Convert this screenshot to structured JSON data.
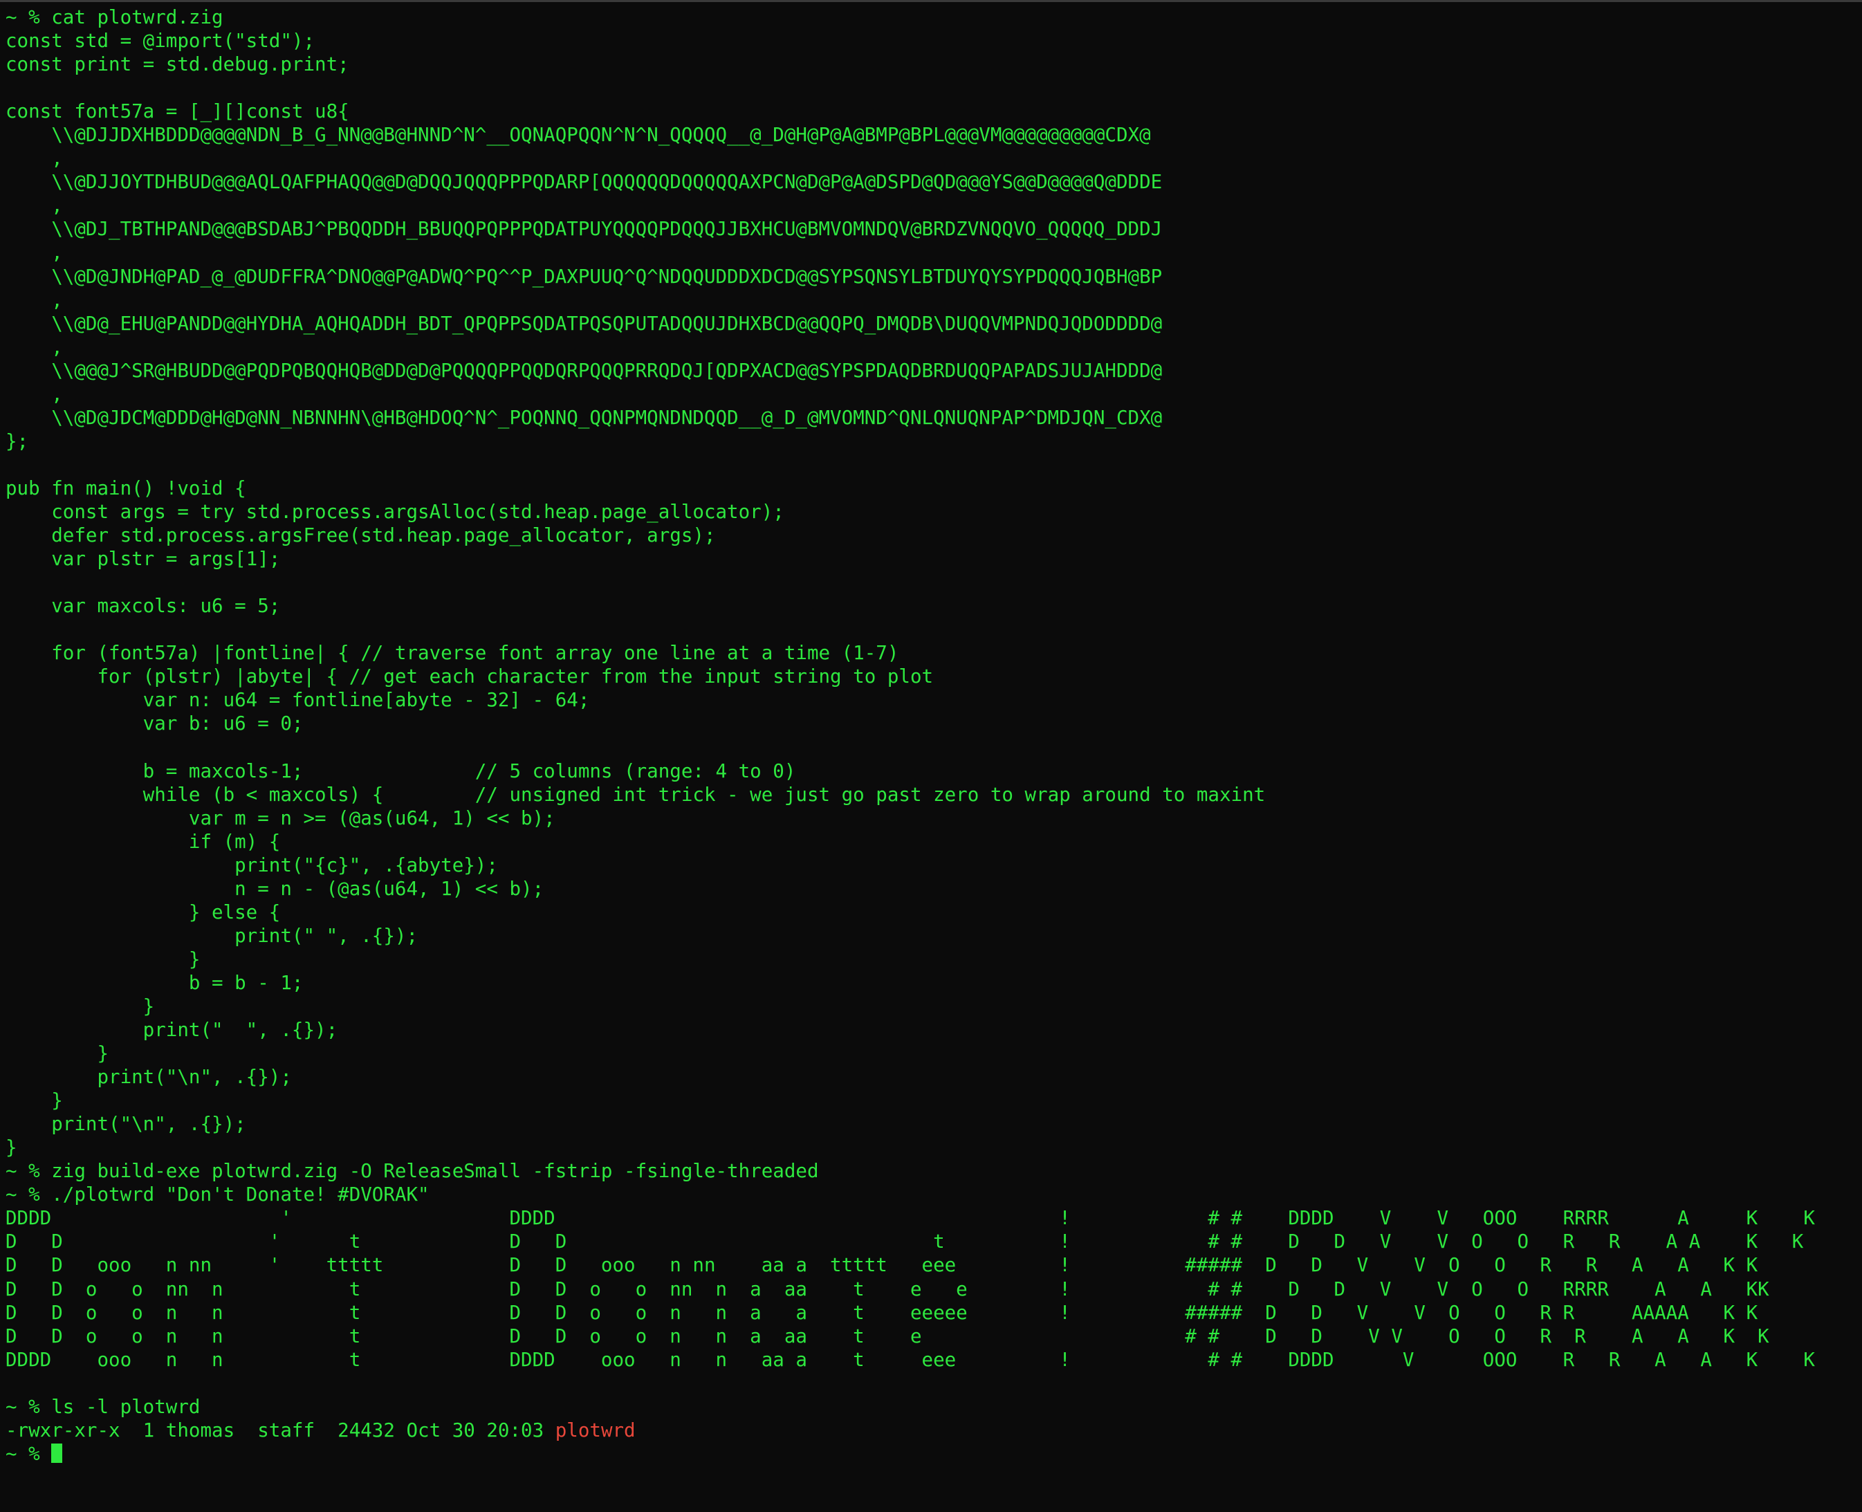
{
  "colors": {
    "background": "#0b0b0b",
    "text": "#2ee83f",
    "filename_highlight": "#e8473a"
  },
  "terminal": {
    "lines": [
      "~ % cat plotwrd.zig",
      "const std = @import(\"std\");",
      "const print = std.debug.print;",
      "",
      "const font57a = [_][]const u8{",
      "    \\\\@DJJDXHBDDD@@@@NDN_B_G_NN@@B@HNND^N^__OQNAQPQQN^N^N_QQQQQ__@_D@H@P@A@BMP@BPL@@@VM@@@@@@@@@CDX@",
      "    ,",
      "    \\\\@DJJOYTDHBUD@@@AQLQAFPHAQQ@@D@DQQJQQQPPPQDARP[QQQQQQDQQQQQAXPCN@D@P@A@DSPD@QD@@@YS@@D@@@@Q@DDDE",
      "    ,",
      "    \\\\@DJ_TBTHPAND@@@BSDABJ^PBQQDDH_BBUQQPQPPPQDATPUYQQQQPDQQQJJBXHCU@BMVOMNDQV@BRDZVNQQVO_QQQQQ_DDDJ",
      "    ,",
      "    \\\\@D@JNDH@PAD_@_@DUDFFRA^DNO@@P@ADWQ^PQ^^P_DAXPUUQ^Q^NDQQUDDDXDCD@@SYPSQNSYLBTDUYQYSYPDQQQJQBH@BP",
      "    ,",
      "    \\\\@D@_EHU@PANDD@@HYDHA_AQHQADDH_BDT_QPQPPSQDATPQSQPUTADQQUJDHXBCD@@QQPQ_DMQDB\\DUQQVMPNDQJQDODDDD@",
      "    ,",
      "    \\\\@@@J^SR@HBUDD@@PQDPQBQQHQB@DD@D@PQQQQPPQQDQRPQQQPRRQDQJ[QDPXACD@@SYPSPDAQDBRDUQQPAPADSJUJAHDDD@",
      "    ,",
      "    \\\\@D@JDCM@DDD@H@D@NN_NBNNHN\\@HB@HDOQ^N^_POQNNQ_QQNPMQNDNDQQD__@_D_@MVOMND^QNLQNUQNPAP^DMDJQN_CDX@",
      "};",
      "",
      "pub fn main() !void {",
      "    const args = try std.process.argsAlloc(std.heap.page_allocator);",
      "    defer std.process.argsFree(std.heap.page_allocator, args);",
      "    var plstr = args[1];",
      "",
      "    var maxcols: u6 = 5;",
      "",
      "    for (font57a) |fontline| { // traverse font array one line at a time (1-7)",
      "        for (plstr) |abyte| { // get each character from the input string to plot",
      "            var n: u64 = fontline[abyte - 32] - 64;",
      "            var b: u6 = 0;",
      "",
      "            b = maxcols-1;               // 5 columns (range: 4 to 0)",
      "            while (b < maxcols) {        // unsigned int trick - we just go past zero to wrap around to maxint",
      "                var m = n >= (@as(u64, 1) << b);",
      "                if (m) {",
      "                    print(\"{c}\", .{abyte});",
      "                    n = n - (@as(u64, 1) << b);",
      "                } else {",
      "                    print(\" \", .{});",
      "                }",
      "                b = b - 1;",
      "            }",
      "            print(\"  \", .{});",
      "        }",
      "        print(\"\\n\", .{});",
      "    }",
      "    print(\"\\n\", .{});",
      "}",
      "~ % zig build-exe plotwrd.zig -O ReleaseSmall -fstrip -fsingle-threaded",
      "~ % ./plotwrd \"Don't Donate! #DVORAK\"",
      "DDDD                    '                   DDDD                                            !            # #    DDDD    V    V   OOO    RRRR      A     K    K",
      "D   D                  '      t             D   D                                t          !            # #    D   D   V    V  O   O   R   R    A A    K   K",
      "D   D   ooo   n nn     '    ttttt           D   D   ooo   n nn    aa a  ttttt   eee         !          #####  D   D   V    V  O   O   R   R   A   A   K K",
      "D   D  o   o  nn  n           t             D   D  o   o  nn  n  a  aa    t    e   e        !            # #    D   D   V    V  O   O   RRRR    A   A   KK",
      "D   D  o   o  n   n           t             D   D  o   o  n   n  a   a    t    eeeee        !          #####  D   D   V    V  O   O   R R     AAAAA   K K",
      "D   D  o   o  n   n           t             D   D  o   o  n   n  a  aa    t    e                       # #    D   D    V V    O   O   R  R    A   A   K  K",
      "DDDD    ooo   n   n           t             DDDD    ooo   n   n   aa a    t     eee         !            # #    DDDD      V      OOO    R   R   A   A   K    K",
      "",
      "~ % ls -l plotwrd"
    ],
    "ls_output": {
      "meta": "-rwxr-xr-x  1 thomas  staff  24432 Oct 30 20:03 ",
      "file": "plotwrd"
    },
    "final_prompt": "~ % "
  }
}
